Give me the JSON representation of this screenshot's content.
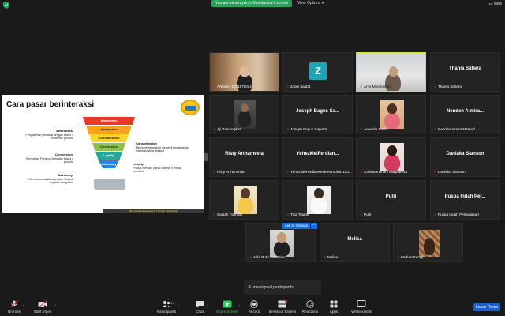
{
  "topbar": {
    "viewing_text": "You are viewing Aryo Moedantos's screen",
    "view_options": "View Options",
    "view": "View"
  },
  "slide": {
    "title": "Cara pasar berinteraksi",
    "funnel": [
      "Awareness",
      "Awareness",
      "Consideration",
      "Conversion",
      "Loyalty",
      "Advocacy"
    ],
    "left_blocks": [
      {
        "head": "Awareness",
        "body": "Pengalaman pertama dengan brand / informasi produk"
      },
      {
        "head": "Conversion",
        "body": "Pembelian Pertama terhadap brand / produk"
      },
      {
        "head": "Advocacy",
        "body": "Merekomendasikan produk / brand kepada orang lain"
      }
    ],
    "right_blocks": [
      {
        "head": "Consideration",
        "body": "Mempertimbangkan membeli berdasarkan informasi yang didapat"
      },
      {
        "head": "Loyalty",
        "body": "Produk menjadi pilihan utama, Kembali membeli"
      }
    ],
    "footer": "Reinventing Experiences Through Technology"
  },
  "tiles": [
    {
      "label": "ANNISA-1201170024",
      "name": ""
    },
    {
      "label": "zoom baa04",
      "name": ""
    },
    {
      "label": "Aryo Moedantoro",
      "name": ""
    },
    {
      "label": "Thania Safiera",
      "name": "Thania Safiera"
    },
    {
      "label": "Aji Pamungkas",
      "name": ""
    },
    {
      "label": "Joseph Bagus Saputra",
      "name": "Joseph Bagus Sa..."
    },
    {
      "label": "Amanda Sovia",
      "name": ""
    },
    {
      "label": "Nenden Almira Marsad",
      "name": "Nenden Almira..."
    },
    {
      "label": "Risty Arthamevia",
      "name": "Risty Arthamevia"
    },
    {
      "label": "YehezkielFerdianKevinRumbiak-120...",
      "name": "YehezkielFerdian..."
    },
    {
      "label": "Carlina Indriani Magdalena",
      "name": ""
    },
    {
      "label": "Daniaka Sianson",
      "name": "Daniaka Sianson"
    },
    {
      "label": "Saidah Fatimah",
      "name": ""
    },
    {
      "label": "Tika Trijanti",
      "name": ""
    },
    {
      "label": "Putri",
      "name": "Putri"
    },
    {
      "label": "Puspa Indah Permatasari",
      "name": "Puspa Indah Per..."
    },
    {
      "label": "Alifa Putri Salsabila",
      "name": ""
    },
    {
      "label": "Melisa",
      "name": "Melisa"
    },
    {
      "label": "Farhan Farisy",
      "name": ""
    }
  ],
  "z_avatar": "Z",
  "ask_to_unmute": "Ask to Unmute",
  "ask_more": "···",
  "unassigned": "4 unassigned participants",
  "toolbar": {
    "unmute": "Unmute",
    "start_video": "Start Video",
    "participants": "Participants",
    "participants_count": "19",
    "chat": "Chat",
    "share_screen": "Share Screen",
    "record": "Record",
    "breakout_rooms": "Breakout Rooms",
    "reactions": "Reactions",
    "apps": "Apps",
    "whiteboards": "Whiteboards",
    "leave_room": "Leave Room"
  },
  "colors": {
    "active_speaker": "#c8e04a",
    "green": "#23a55a",
    "blue": "#0e71eb"
  }
}
